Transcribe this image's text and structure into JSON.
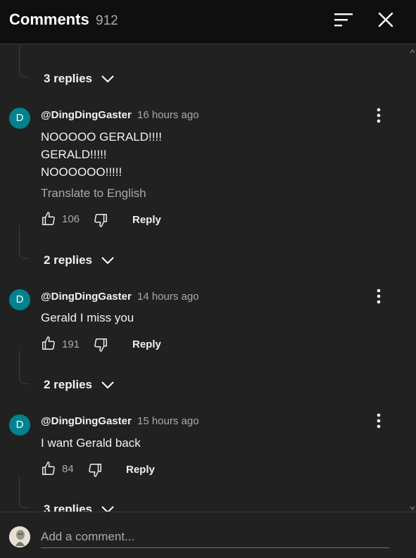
{
  "header": {
    "title": "Comments",
    "count": "912"
  },
  "threads": [
    {
      "replies_label": "3 replies"
    },
    {
      "replies_label": "2 replies"
    },
    {
      "replies_label": "2 replies"
    },
    {
      "replies_label": "3 replies"
    }
  ],
  "comments": [
    {
      "avatar_letter": "D",
      "author": "@DingDingGaster",
      "time": "16 hours ago",
      "lines": [
        "NOOOOO GERALD!!!!",
        "GERALD!!!!!",
        "NOOOOOO!!!!!"
      ],
      "translate_label": "Translate to English",
      "likes": "106",
      "reply_label": "Reply"
    },
    {
      "avatar_letter": "D",
      "author": "@DingDingGaster",
      "time": "14 hours ago",
      "lines": [
        "Gerald I miss you"
      ],
      "likes": "191",
      "reply_label": "Reply"
    },
    {
      "avatar_letter": "D",
      "author": "@DingDingGaster",
      "time": "15 hours ago",
      "lines": [
        "I want Gerald back"
      ],
      "likes": "84",
      "reply_label": "Reply"
    }
  ],
  "footer": {
    "placeholder": "Add a comment..."
  },
  "colors": {
    "background": "#212121",
    "header_background": "#0f0f0f",
    "avatar": "#00838f",
    "secondary_text": "#aaaaaa"
  },
  "icons": [
    "sort-icon",
    "close-icon",
    "chevron-down-icon",
    "more-vertical-icon",
    "thumbs-up-icon",
    "thumbs-down-icon"
  ]
}
